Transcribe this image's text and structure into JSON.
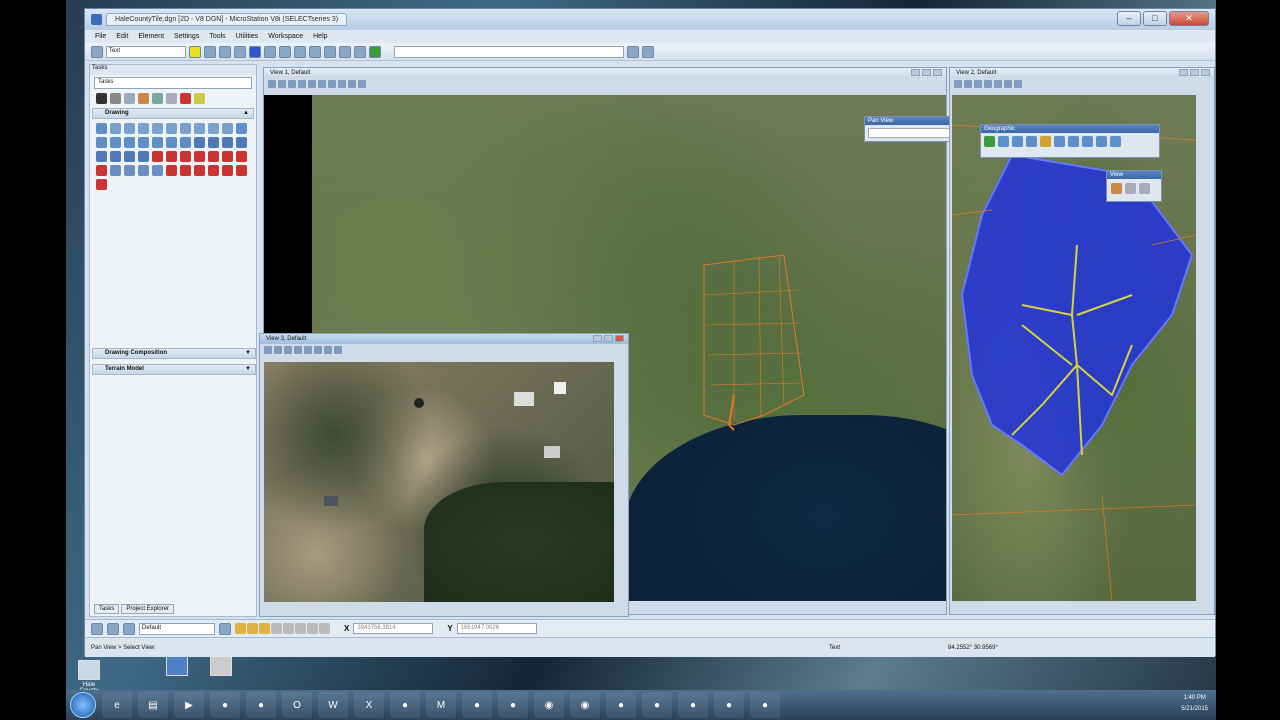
{
  "window": {
    "title": "HaleCountyTile.dgn [2D - V8 DGN] - MicroStation V8i (SELECTseries 3)",
    "tab": "HaleCountyTile.dgn [2D - V8 DGN]"
  },
  "menu": [
    "File",
    "Edit",
    "Element",
    "Settings",
    "Tools",
    "Utilities",
    "Workspace",
    "Help"
  ],
  "toolbar": {
    "level": "Text"
  },
  "tasks": {
    "header": "Tasks",
    "combo": "Tasks",
    "sections": {
      "drawing": "Drawing",
      "composition": "Drawing Composition",
      "terrain": "Terrain Model"
    },
    "bottom_tabs": [
      "Tasks",
      "Project Explorer"
    ]
  },
  "views": {
    "v1": "View 1, Default",
    "v2": "View 2, Default",
    "v3": "View 3, Default"
  },
  "floats": {
    "pan": "Pan View",
    "geo": "Geographic",
    "view": "View"
  },
  "status": {
    "level_combo": "Default",
    "x_label": "X",
    "y_label": "Y",
    "x_value": "3943756.3814",
    "y_value": "1661947.0026",
    "prompt": "Pan View > Select View",
    "text_level": "Text",
    "coords": "84.2552° 30.9569°"
  },
  "desktop": {
    "icons": [
      "Hale County",
      "",
      ""
    ]
  },
  "taskbar": {
    "time": "1:40 PM",
    "date": "5/21/2015"
  },
  "colors": {
    "accent": "#3a6fb8",
    "orange": "#e07b22",
    "yellow": "#d6d23c",
    "blue": "#2233dd"
  }
}
